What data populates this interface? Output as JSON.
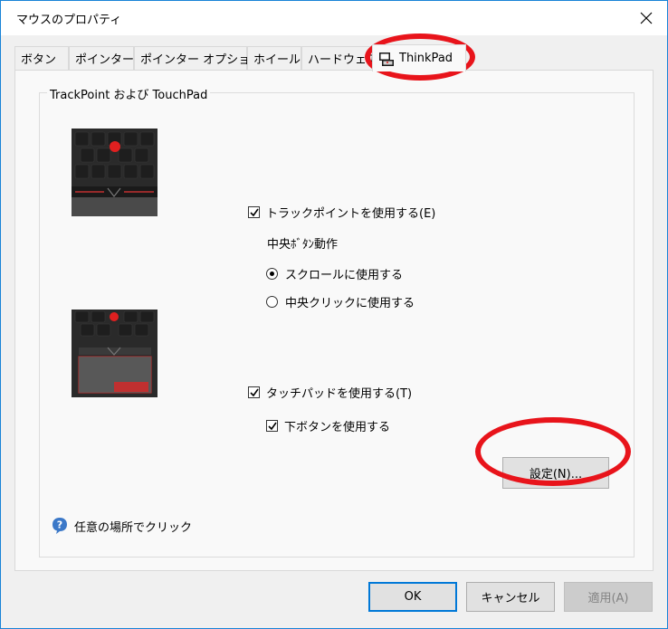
{
  "window": {
    "title": "マウスのプロパティ",
    "close_icon": "close-icon"
  },
  "tabs": [
    {
      "label": "ボタン"
    },
    {
      "label": "ポインター"
    },
    {
      "label": "ポインター オプション"
    },
    {
      "label": "ホイール"
    },
    {
      "label": "ハードウェア"
    },
    {
      "label": "ThinkPad",
      "icon": "thinkpad-icon",
      "active": true
    }
  ],
  "group": {
    "label": "TrackPoint および TouchPad"
  },
  "trackpoint": {
    "enable_label": "トラックポイントを使用する(E)",
    "enable_checked": true,
    "middle_button_label": "中央ﾎﾞﾀﾝ動作",
    "scroll_label": "スクロールに使用する",
    "scroll_selected": true,
    "middle_click_label": "中央クリックに使用する",
    "middle_click_selected": false
  },
  "touchpad": {
    "enable_label": "タッチパッドを使用する(T)",
    "enable_checked": true,
    "lower_buttons_label": "下ボタンを使用する",
    "lower_buttons_checked": true
  },
  "help": {
    "icon": "question-icon",
    "text": "任意の場所でクリック"
  },
  "settings_button": "設定(N)...",
  "footer": {
    "ok": "OK",
    "cancel": "キャンセル",
    "apply": "適用(A)"
  },
  "colors": {
    "accent": "#0078d7",
    "annotation_red": "#e8141b",
    "trackpoint_red": "#e02020"
  }
}
